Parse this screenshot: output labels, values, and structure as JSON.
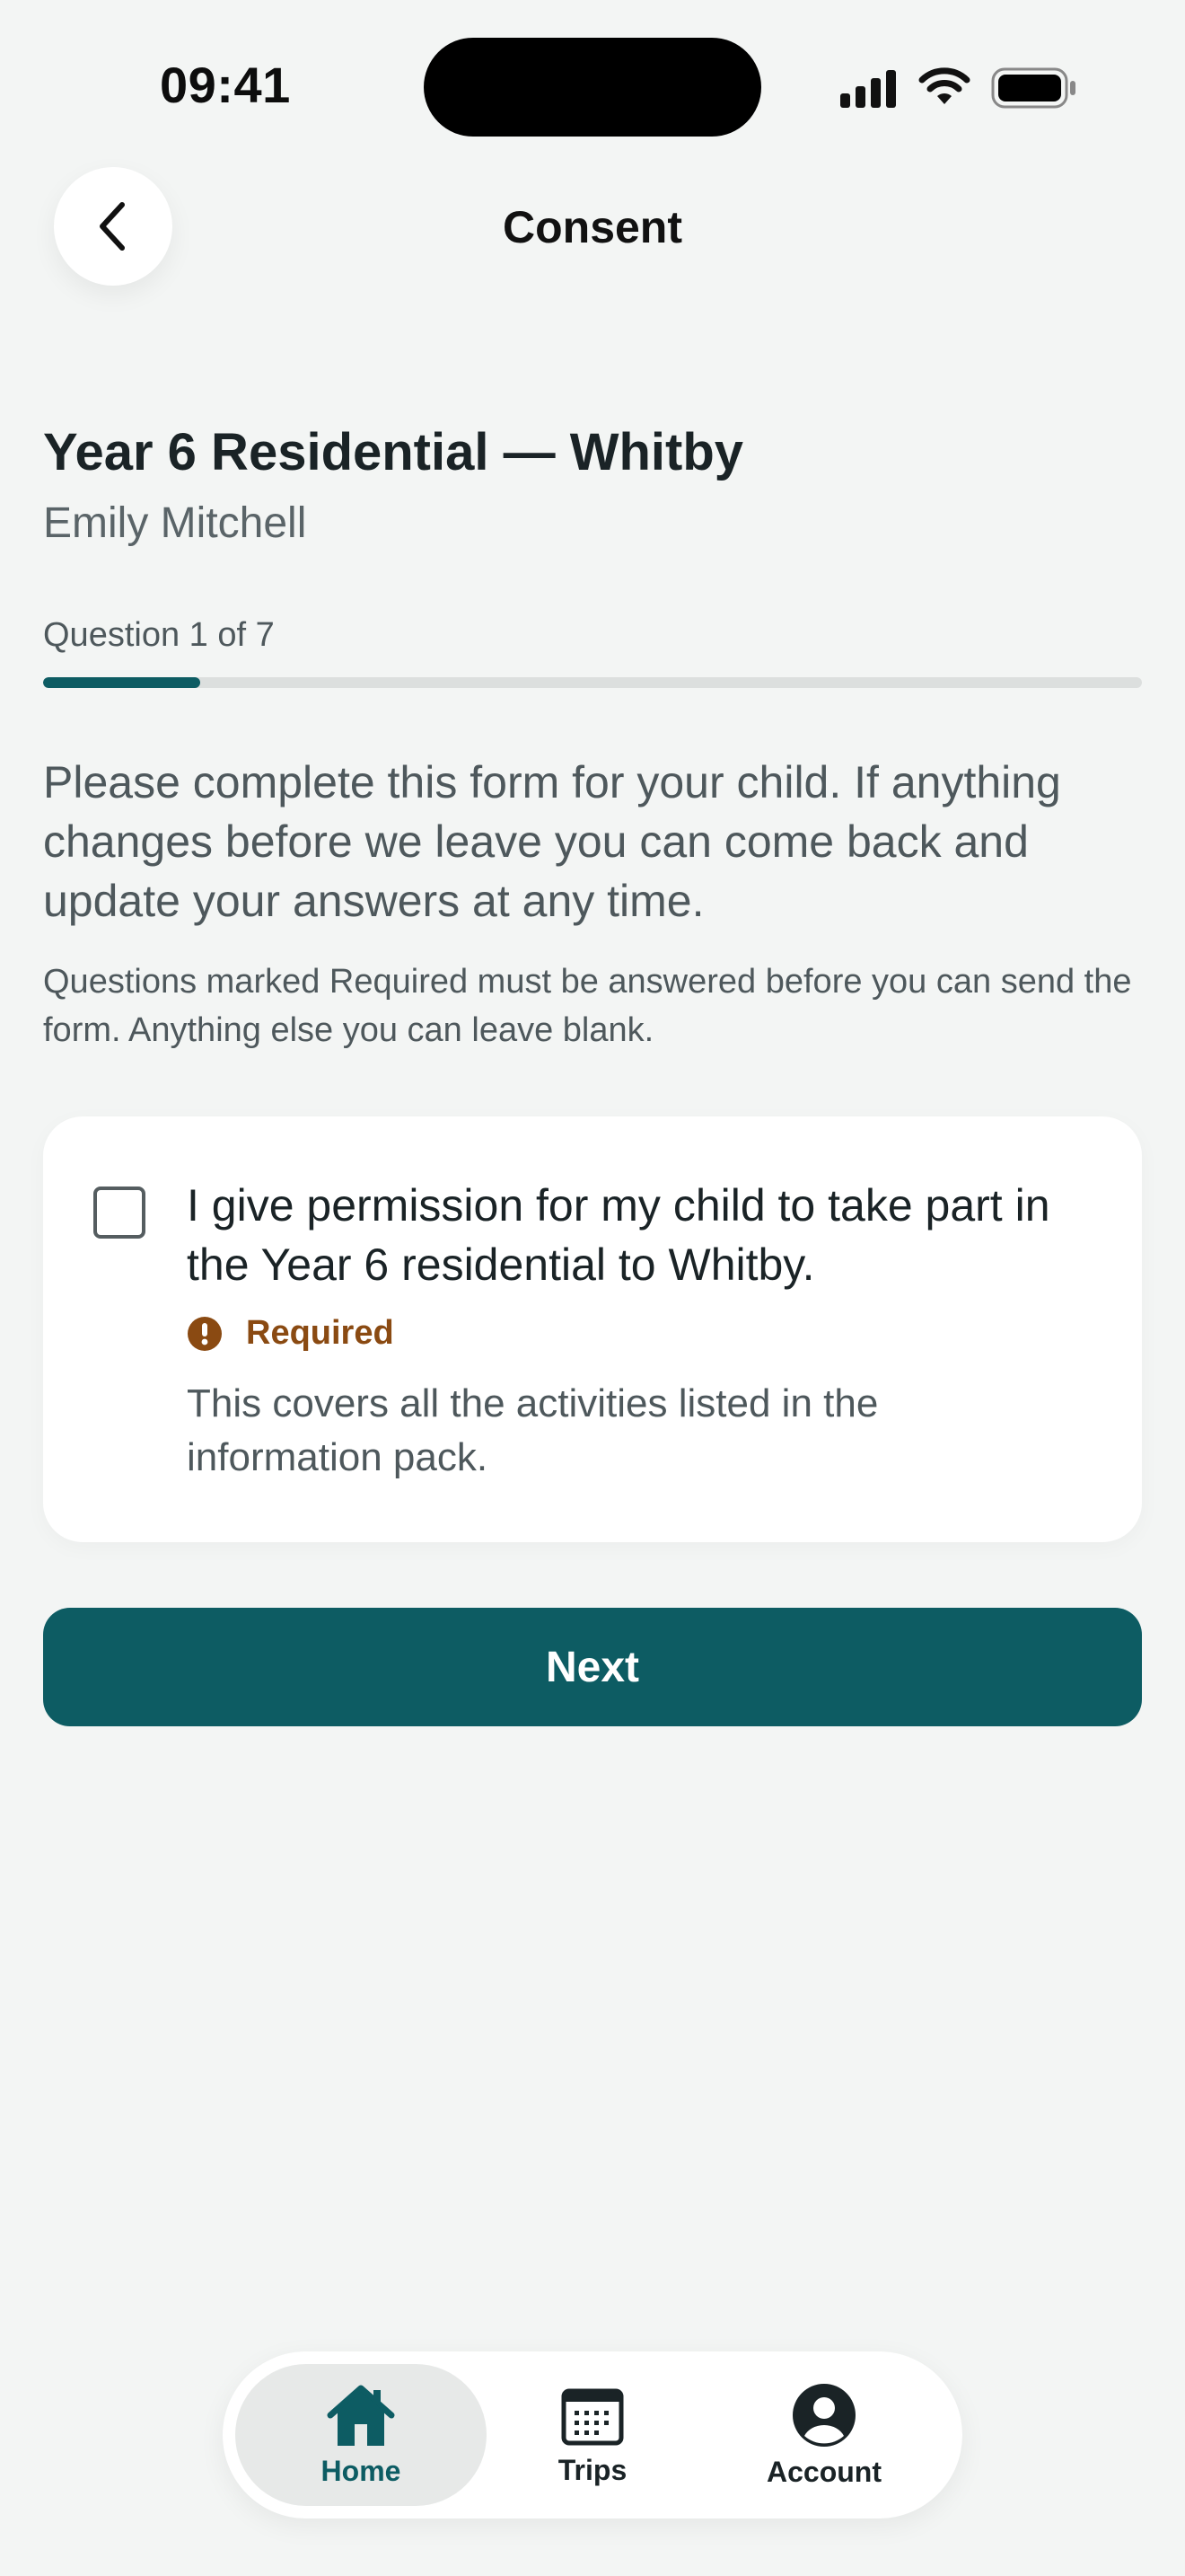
{
  "status_bar": {
    "time": "09:41"
  },
  "nav": {
    "title": "Consent"
  },
  "header": {
    "trip_title": "Year 6 Residential — Whitby",
    "child_name": "Emily Mitchell"
  },
  "progress": {
    "label": "Question 1 of 7",
    "current": 1,
    "total": 7
  },
  "intro": "Please complete this form for your child. If anything changes before we leave you can come back and update your answers at any time.",
  "note": "Questions marked Required must be answered before you can send the form. Anything else you can leave blank.",
  "question": {
    "text": "I give permission for my child to take part in the Year 6 residential to Whitby.",
    "checked": false,
    "required_label": "Required",
    "help": "This covers all the activities listed in the information pack."
  },
  "next_label": "Next",
  "tabs": [
    {
      "label": "Home",
      "icon": "home-icon",
      "active": true
    },
    {
      "label": "Trips",
      "icon": "calendar-icon",
      "active": false
    },
    {
      "label": "Account",
      "icon": "account-icon",
      "active": false
    }
  ],
  "colors": {
    "accent": "#0d5c63",
    "required": "#8a4a12",
    "background": "#f3f5f4"
  }
}
